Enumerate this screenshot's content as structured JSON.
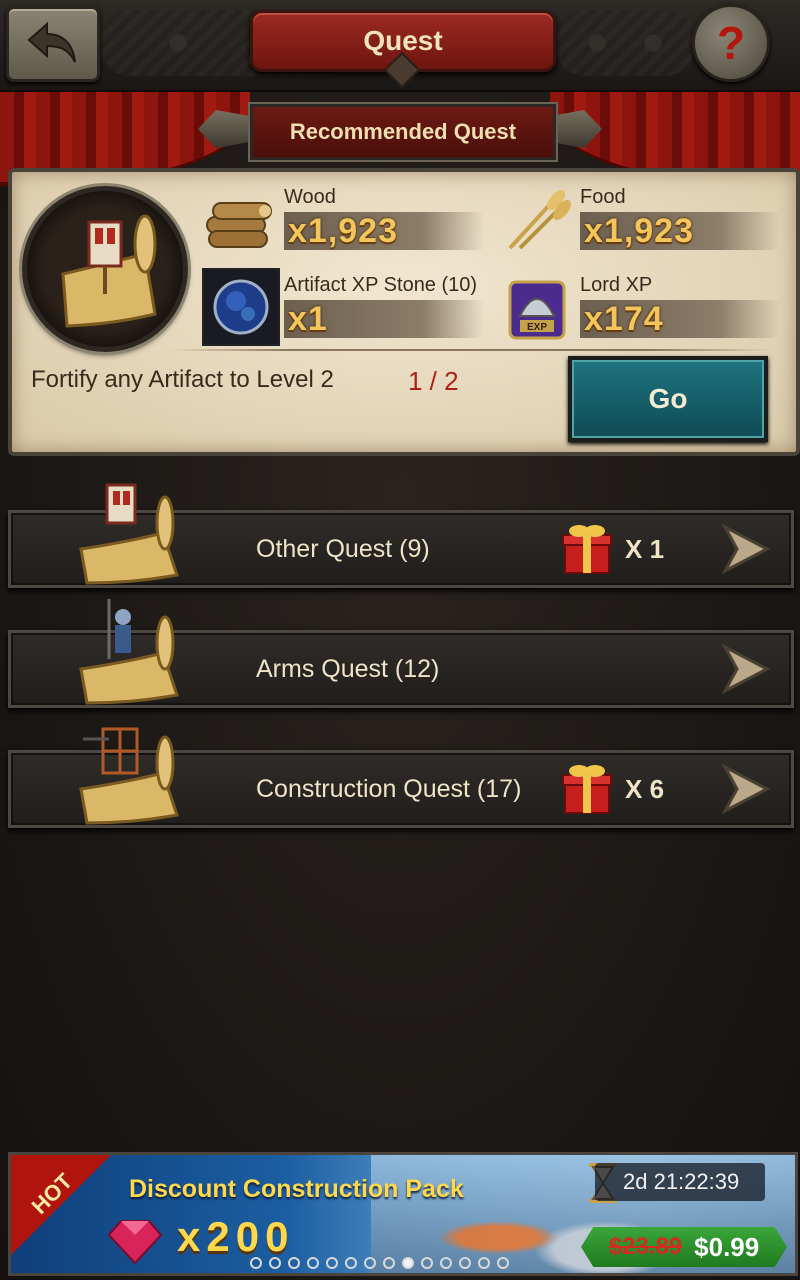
{
  "header": {
    "title": "Quest",
    "back_icon": "back-arrow-icon",
    "help_label": "?"
  },
  "recommended": {
    "title": "Recommended Quest",
    "rewards": [
      {
        "name": "Wood",
        "amount": "x1,923",
        "icon": "wood-logs-icon"
      },
      {
        "name": "Food",
        "amount": "x1,923",
        "icon": "wheat-icon"
      },
      {
        "name": "Artifact XP Stone (10)",
        "amount": "x1",
        "icon": "artifact-stone-icon"
      },
      {
        "name": "Lord XP",
        "amount": "x174",
        "icon": "lord-xp-helmet-icon"
      }
    ],
    "objective": "Fortify any Artifact to Level 2",
    "progress": "1 / 2",
    "go_label": "Go"
  },
  "categories": [
    {
      "label": "Other Quest  (9)",
      "gift_count": "X 1",
      "has_gift": true
    },
    {
      "label": "Arms Quest  (12)",
      "gift_count": "",
      "has_gift": false
    },
    {
      "label": "Construction Quest  (17)",
      "gift_count": "X 6",
      "has_gift": true
    }
  ],
  "offer": {
    "badge": "HOT",
    "title": "Discount Construction Pack",
    "count": "x200",
    "timer": "2d 21:22:39",
    "old_price": "$23.89",
    "new_price": "$0.99",
    "pages": 14,
    "active_page": 8
  },
  "colors": {
    "accent_red": "#9b2a22",
    "go_button": "#1e7580",
    "gold_text": "#f3c55a",
    "progress_red": "#b31e14"
  }
}
